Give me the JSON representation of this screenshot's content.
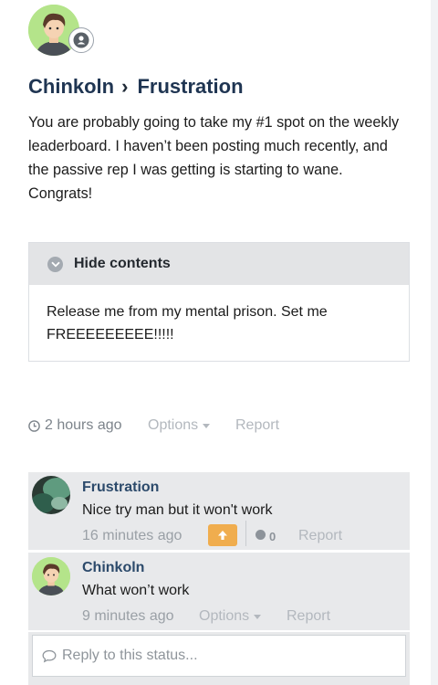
{
  "status": {
    "author": "Chinkoln",
    "separator": "›",
    "target": "Frustration",
    "paragraph": "You are probably going to take my #1 spot on the weekly leaderboard. I haven’t been posting much recently, and the passive rep I was getting is starting to wane.",
    "closing": "Congrats!",
    "spoiler": {
      "label": "Hide contents",
      "text": "Release me from my mental prison. Set me FREEEEEEEEE!!!!!"
    },
    "meta": {
      "time": "2 hours ago",
      "options": "Options",
      "report": "Report"
    }
  },
  "comments": [
    {
      "author": "Frustration",
      "text": "Nice try man but it won't work",
      "time": "16 minutes ago",
      "reputation": "0",
      "report": "Report"
    },
    {
      "author": "Chinkoln",
      "text": "What won’t work",
      "time": "9 minutes ago",
      "options": "Options",
      "report": "Report"
    }
  ],
  "reply": {
    "placeholder": "Reply to this status..."
  },
  "colors": {
    "accent_upvote": "#f0ad4e",
    "name_link": "#2c4a6b",
    "comment_bg": "#e8e9eb"
  }
}
